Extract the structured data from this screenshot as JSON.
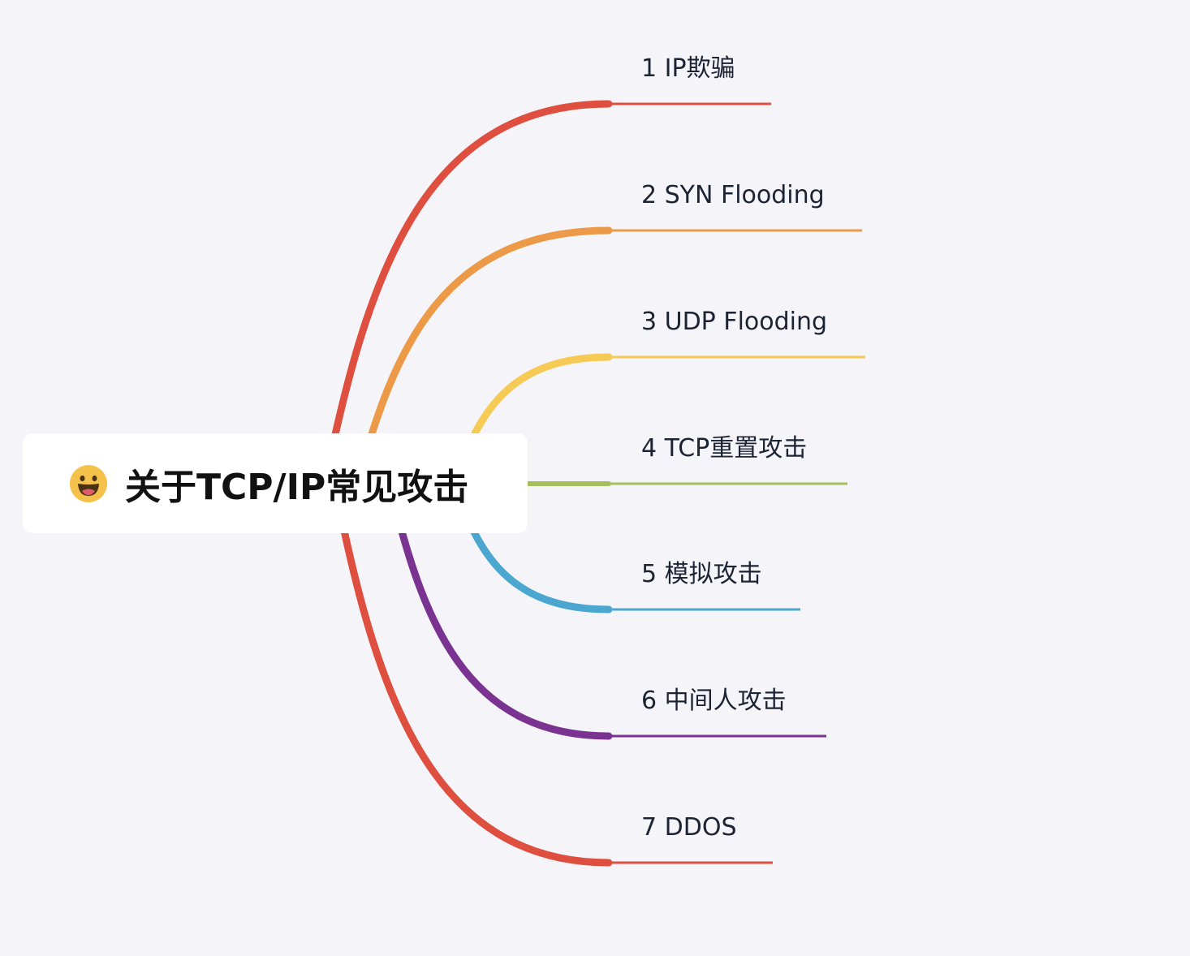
{
  "root": {
    "title": "关于TCP/IP常见攻击",
    "icon": "grinning-face-icon"
  },
  "branches": [
    {
      "label": "1 IP欺骗",
      "color": "#de4f3f"
    },
    {
      "label": "2 SYN Flooding",
      "color": "#ec9a47"
    },
    {
      "label": "3 UDP Flooding",
      "color": "#f6cb55"
    },
    {
      "label": "4 TCP重置攻击",
      "color": "#a3c05a"
    },
    {
      "label": "5 模拟攻击",
      "color": "#4ba7d0"
    },
    {
      "label": "6 中间人攻击",
      "color": "#7a3391"
    },
    {
      "label": "7 DDOS",
      "color": "#de4f3f"
    }
  ],
  "colors": {
    "background": "#f5f5f9",
    "root_fill": "#ffffff",
    "text": "#1c2333"
  }
}
